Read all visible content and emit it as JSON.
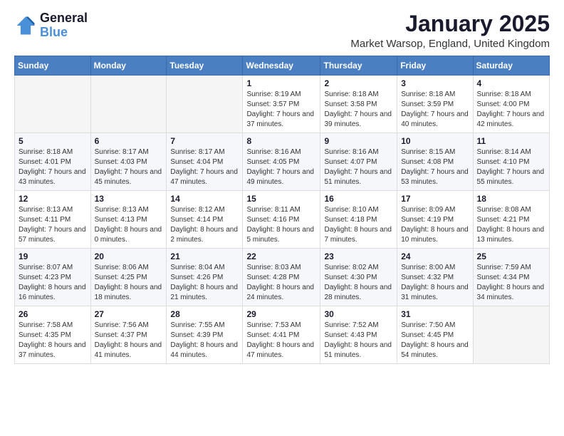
{
  "logo": {
    "line1": "General",
    "line2": "Blue"
  },
  "title": "January 2025",
  "location": "Market Warsop, England, United Kingdom",
  "weekdays": [
    "Sunday",
    "Monday",
    "Tuesday",
    "Wednesday",
    "Thursday",
    "Friday",
    "Saturday"
  ],
  "weeks": [
    [
      {
        "day": "",
        "info": ""
      },
      {
        "day": "",
        "info": ""
      },
      {
        "day": "",
        "info": ""
      },
      {
        "day": "1",
        "info": "Sunrise: 8:19 AM\nSunset: 3:57 PM\nDaylight: 7 hours and 37 minutes."
      },
      {
        "day": "2",
        "info": "Sunrise: 8:18 AM\nSunset: 3:58 PM\nDaylight: 7 hours and 39 minutes."
      },
      {
        "day": "3",
        "info": "Sunrise: 8:18 AM\nSunset: 3:59 PM\nDaylight: 7 hours and 40 minutes."
      },
      {
        "day": "4",
        "info": "Sunrise: 8:18 AM\nSunset: 4:00 PM\nDaylight: 7 hours and 42 minutes."
      }
    ],
    [
      {
        "day": "5",
        "info": "Sunrise: 8:18 AM\nSunset: 4:01 PM\nDaylight: 7 hours and 43 minutes."
      },
      {
        "day": "6",
        "info": "Sunrise: 8:17 AM\nSunset: 4:03 PM\nDaylight: 7 hours and 45 minutes."
      },
      {
        "day": "7",
        "info": "Sunrise: 8:17 AM\nSunset: 4:04 PM\nDaylight: 7 hours and 47 minutes."
      },
      {
        "day": "8",
        "info": "Sunrise: 8:16 AM\nSunset: 4:05 PM\nDaylight: 7 hours and 49 minutes."
      },
      {
        "day": "9",
        "info": "Sunrise: 8:16 AM\nSunset: 4:07 PM\nDaylight: 7 hours and 51 minutes."
      },
      {
        "day": "10",
        "info": "Sunrise: 8:15 AM\nSunset: 4:08 PM\nDaylight: 7 hours and 53 minutes."
      },
      {
        "day": "11",
        "info": "Sunrise: 8:14 AM\nSunset: 4:10 PM\nDaylight: 7 hours and 55 minutes."
      }
    ],
    [
      {
        "day": "12",
        "info": "Sunrise: 8:13 AM\nSunset: 4:11 PM\nDaylight: 7 hours and 57 minutes."
      },
      {
        "day": "13",
        "info": "Sunrise: 8:13 AM\nSunset: 4:13 PM\nDaylight: 8 hours and 0 minutes."
      },
      {
        "day": "14",
        "info": "Sunrise: 8:12 AM\nSunset: 4:14 PM\nDaylight: 8 hours and 2 minutes."
      },
      {
        "day": "15",
        "info": "Sunrise: 8:11 AM\nSunset: 4:16 PM\nDaylight: 8 hours and 5 minutes."
      },
      {
        "day": "16",
        "info": "Sunrise: 8:10 AM\nSunset: 4:18 PM\nDaylight: 8 hours and 7 minutes."
      },
      {
        "day": "17",
        "info": "Sunrise: 8:09 AM\nSunset: 4:19 PM\nDaylight: 8 hours and 10 minutes."
      },
      {
        "day": "18",
        "info": "Sunrise: 8:08 AM\nSunset: 4:21 PM\nDaylight: 8 hours and 13 minutes."
      }
    ],
    [
      {
        "day": "19",
        "info": "Sunrise: 8:07 AM\nSunset: 4:23 PM\nDaylight: 8 hours and 16 minutes."
      },
      {
        "day": "20",
        "info": "Sunrise: 8:06 AM\nSunset: 4:25 PM\nDaylight: 8 hours and 18 minutes."
      },
      {
        "day": "21",
        "info": "Sunrise: 8:04 AM\nSunset: 4:26 PM\nDaylight: 8 hours and 21 minutes."
      },
      {
        "day": "22",
        "info": "Sunrise: 8:03 AM\nSunset: 4:28 PM\nDaylight: 8 hours and 24 minutes."
      },
      {
        "day": "23",
        "info": "Sunrise: 8:02 AM\nSunset: 4:30 PM\nDaylight: 8 hours and 28 minutes."
      },
      {
        "day": "24",
        "info": "Sunrise: 8:00 AM\nSunset: 4:32 PM\nDaylight: 8 hours and 31 minutes."
      },
      {
        "day": "25",
        "info": "Sunrise: 7:59 AM\nSunset: 4:34 PM\nDaylight: 8 hours and 34 minutes."
      }
    ],
    [
      {
        "day": "26",
        "info": "Sunrise: 7:58 AM\nSunset: 4:35 PM\nDaylight: 8 hours and 37 minutes."
      },
      {
        "day": "27",
        "info": "Sunrise: 7:56 AM\nSunset: 4:37 PM\nDaylight: 8 hours and 41 minutes."
      },
      {
        "day": "28",
        "info": "Sunrise: 7:55 AM\nSunset: 4:39 PM\nDaylight: 8 hours and 44 minutes."
      },
      {
        "day": "29",
        "info": "Sunrise: 7:53 AM\nSunset: 4:41 PM\nDaylight: 8 hours and 47 minutes."
      },
      {
        "day": "30",
        "info": "Sunrise: 7:52 AM\nSunset: 4:43 PM\nDaylight: 8 hours and 51 minutes."
      },
      {
        "day": "31",
        "info": "Sunrise: 7:50 AM\nSunset: 4:45 PM\nDaylight: 8 hours and 54 minutes."
      },
      {
        "day": "",
        "info": ""
      }
    ]
  ]
}
